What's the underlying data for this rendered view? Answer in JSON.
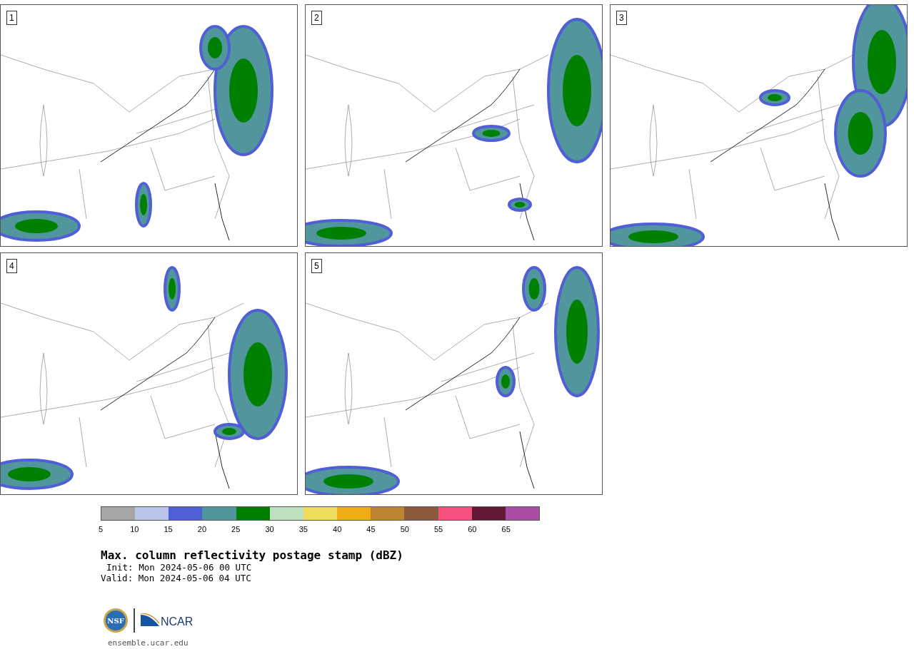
{
  "panels": [
    {
      "label": "1"
    },
    {
      "label": "2"
    },
    {
      "label": "3"
    },
    {
      "label": "4"
    },
    {
      "label": "5"
    }
  ],
  "colorbar": {
    "bins": [
      {
        "color": "#a5a5a5"
      },
      {
        "color": "#b9c4ed"
      },
      {
        "color": "#505fd6"
      },
      {
        "color": "#50969c"
      },
      {
        "color": "#008000"
      },
      {
        "color": "#bddfbd"
      },
      {
        "color": "#efdc5a"
      },
      {
        "color": "#efad15"
      },
      {
        "color": "#bc8330"
      },
      {
        "color": "#8b5a3c"
      },
      {
        "color": "#f5517f"
      },
      {
        "color": "#641937"
      },
      {
        "color": "#ab4ca5"
      }
    ],
    "ticks": [
      "5",
      "10",
      "15",
      "20",
      "25",
      "30",
      "35",
      "40",
      "45",
      "50",
      "55",
      "60",
      "65"
    ]
  },
  "title": "Max. column reflectivity postage stamp (dBZ)",
  "init": "Init: Mon 2024-05-06 00 UTC",
  "valid": "Valid: Mon 2024-05-06 04 UTC",
  "logos": {
    "nsf": "NSF",
    "ncar": "NCAR"
  },
  "url": "ensemble.ucar.edu"
}
